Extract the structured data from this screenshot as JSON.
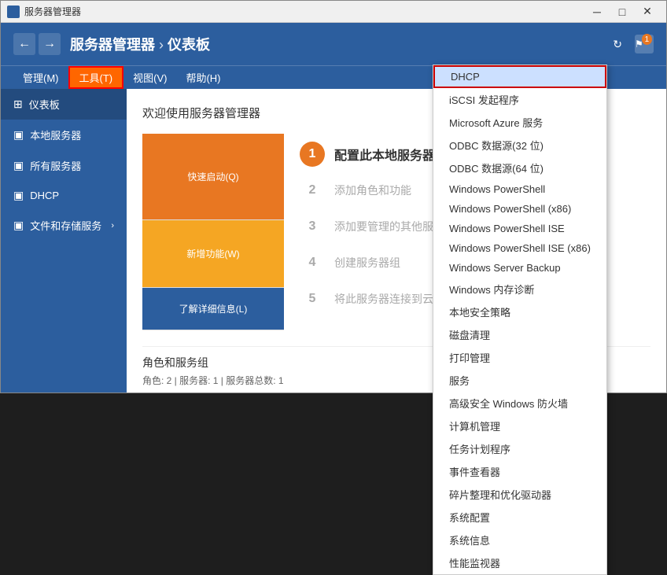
{
  "window": {
    "title": "服务器管理器"
  },
  "titlebar": {
    "title": "服务器管理器",
    "minimize": "─",
    "maximize": "□",
    "close": "✕"
  },
  "toolbar": {
    "nav_back": "←",
    "nav_forward": "→",
    "breadcrumb": "服务器管理器 › 仪表板",
    "refresh_icon": "↻",
    "flag_icon": "⚑",
    "manage_label": "管理(M)",
    "tools_label": "工具(T)",
    "view_label": "视图(V)",
    "help_label": "帮助(H)"
  },
  "sidebar": {
    "items": [
      {
        "id": "dashboard",
        "label": "仪表板",
        "icon": "⊞",
        "active": true
      },
      {
        "id": "local-server",
        "label": "本地服务器",
        "icon": "□"
      },
      {
        "id": "all-servers",
        "label": "所有服务器",
        "icon": "□"
      },
      {
        "id": "dhcp",
        "label": "DHCP",
        "icon": "□"
      },
      {
        "id": "file-services",
        "label": "文件和存储服务",
        "icon": "□",
        "arrow": "›"
      }
    ]
  },
  "content": {
    "welcome_title": "欢迎使用服务器管理器",
    "quick_start_label": "快速启动(Q)",
    "new_features_label": "新增功能(W)",
    "more_info_label": "了解详细信息(L)",
    "steps": [
      {
        "num": "1",
        "label": "配置此本地服务器",
        "active": true
      },
      {
        "num": "2",
        "label": "添加角色和功能",
        "active": false
      },
      {
        "num": "3",
        "label": "添加要管理的其他服务器",
        "active": false
      },
      {
        "num": "4",
        "label": "创建服务器组",
        "active": false
      },
      {
        "num": "5",
        "label": "将此服务器连接到云服务",
        "active": false
      }
    ],
    "roles_section": {
      "title": "角色和服务组",
      "subtitle": "角色: 2 | 服务器: 1 | 服务器总数: 1"
    }
  },
  "dropdown": {
    "items": [
      {
        "id": "dhcp",
        "label": "DHCP",
        "highlighted": true
      },
      {
        "id": "iscsi",
        "label": "iSCSI 发起程序"
      },
      {
        "id": "azure",
        "label": "Microsoft Azure 服务"
      },
      {
        "id": "odbc32",
        "label": "ODBC 数据源(32 位)"
      },
      {
        "id": "odbc64",
        "label": "ODBC 数据源(64 位)"
      },
      {
        "id": "powershell",
        "label": "Windows PowerShell"
      },
      {
        "id": "powershell-x86",
        "label": "Windows PowerShell (x86)"
      },
      {
        "id": "powershell-ise",
        "label": "Windows PowerShell ISE"
      },
      {
        "id": "powershell-ise-x86",
        "label": "Windows PowerShell ISE (x86)"
      },
      {
        "id": "backup",
        "label": "Windows Server Backup"
      },
      {
        "id": "memory-diag",
        "label": "Windows 内存诊断"
      },
      {
        "id": "local-security",
        "label": "本地安全策略"
      },
      {
        "id": "disk-cleanup",
        "label": "磁盘清理"
      },
      {
        "id": "print-mgmt",
        "label": "打印管理"
      },
      {
        "id": "services",
        "label": "服务"
      },
      {
        "id": "firewall",
        "label": "高级安全 Windows 防火墙"
      },
      {
        "id": "computer-mgmt",
        "label": "计算机管理"
      },
      {
        "id": "task-scheduler",
        "label": "任务计划程序"
      },
      {
        "id": "event-viewer",
        "label": "事件查看器"
      },
      {
        "id": "defrag",
        "label": "碎片整理和优化驱动器"
      },
      {
        "id": "sys-config",
        "label": "系统配置"
      },
      {
        "id": "sys-info",
        "label": "系统信息"
      },
      {
        "id": "perf-monitor",
        "label": "性能监视器"
      }
    ]
  },
  "icons": {
    "server": "▣",
    "grid": "⊞",
    "arrow_right": "›",
    "refresh": "↻",
    "flag": "⚑",
    "chevron": "›"
  }
}
